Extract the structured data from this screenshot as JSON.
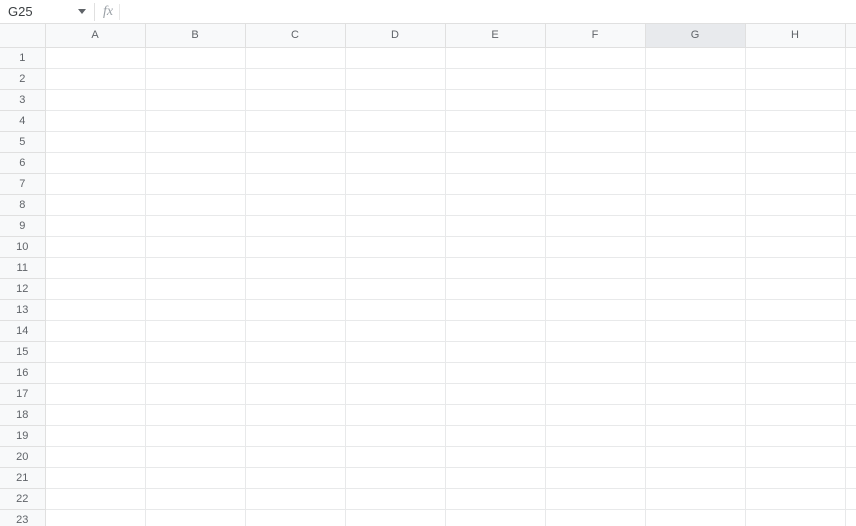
{
  "namebox": {
    "value": "G25"
  },
  "formula_bar": {
    "fx_label": "fx",
    "value": ""
  },
  "grid": {
    "columns": [
      "A",
      "B",
      "C",
      "D",
      "E",
      "F",
      "G",
      "H"
    ],
    "rows": [
      "1",
      "2",
      "3",
      "4",
      "5",
      "6",
      "7",
      "8",
      "9",
      "10",
      "11",
      "12",
      "13",
      "14",
      "15",
      "16",
      "17",
      "18",
      "19",
      "20",
      "21",
      "22",
      "23"
    ],
    "active_column": "G",
    "active_cell": "G25"
  }
}
